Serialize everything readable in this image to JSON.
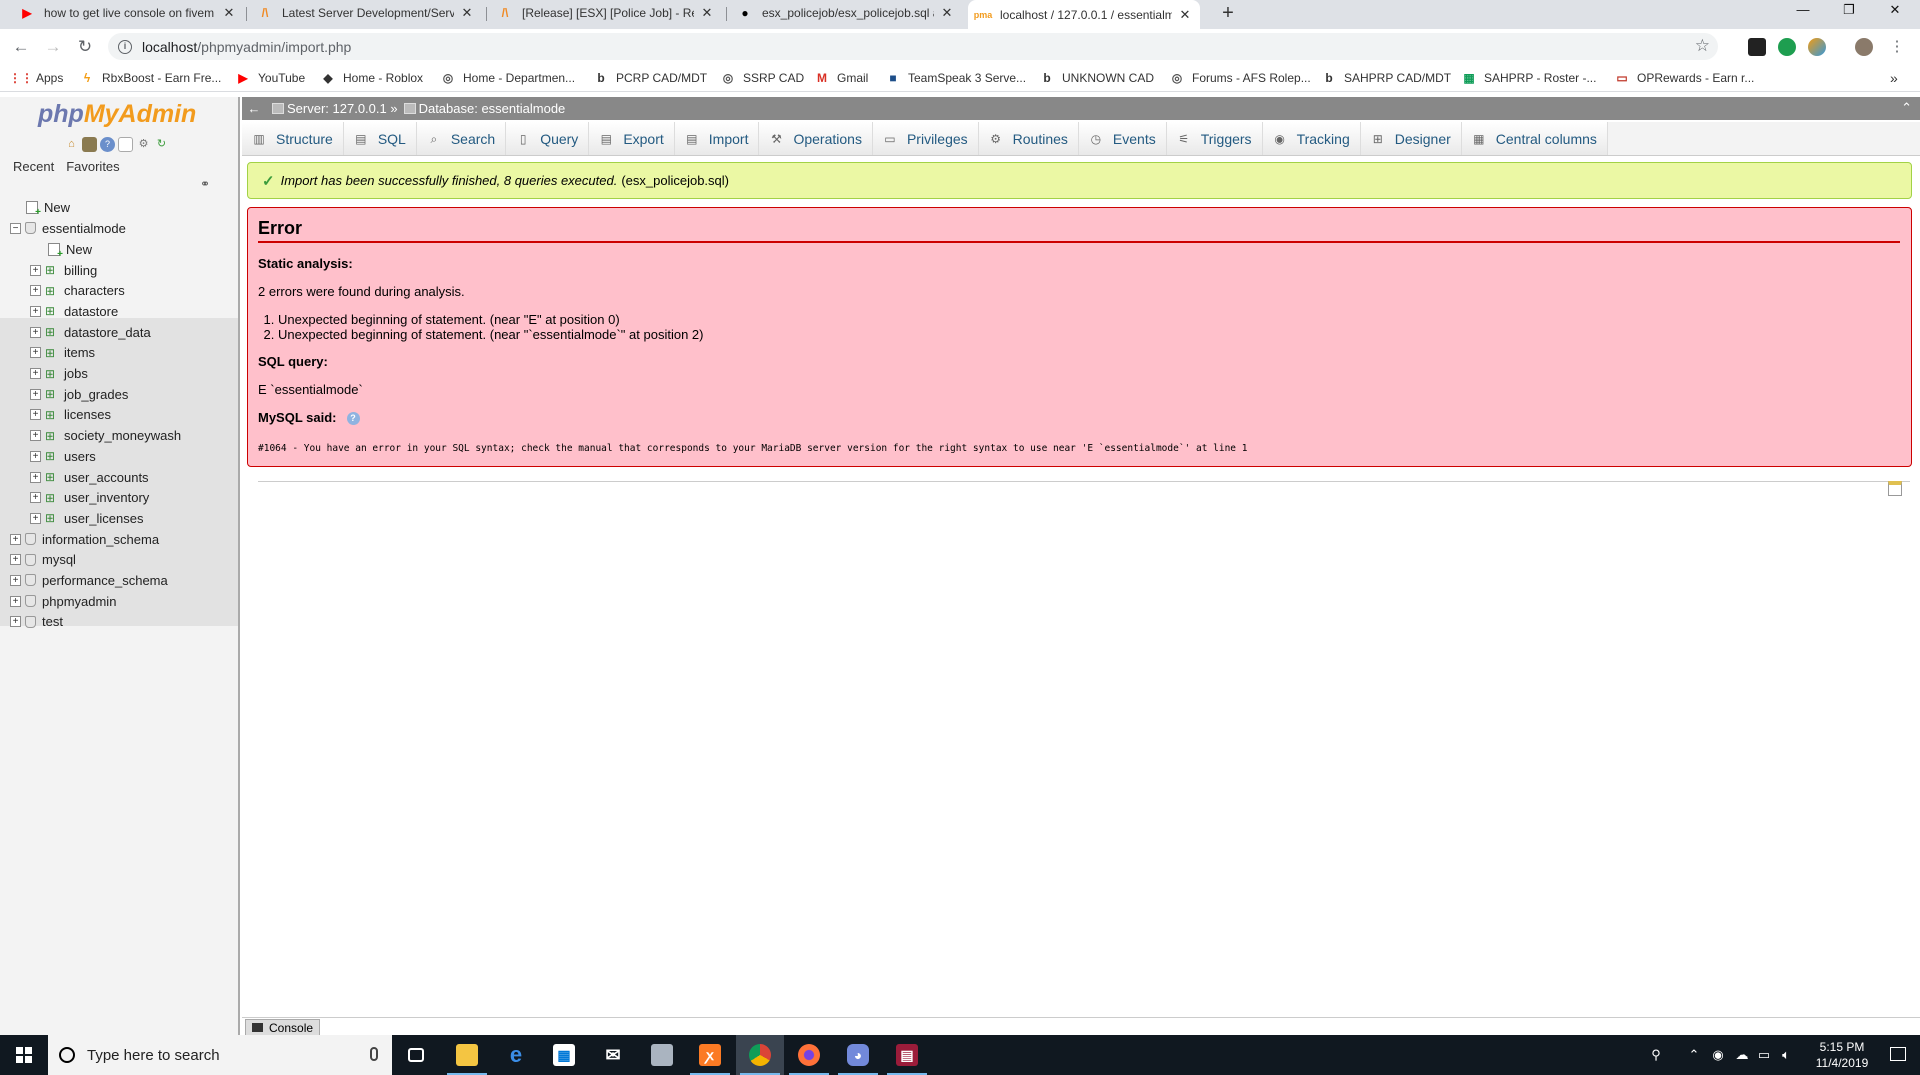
{
  "browser": {
    "tabs": [
      {
        "title": "how to get live console on fivem",
        "icon": "youtube-icon",
        "color": "#ff0000"
      },
      {
        "title": "Latest Server Development/Serve",
        "icon": "fivem-icon",
        "color": "#f08a24"
      },
      {
        "title": "[Release] [ESX] [Police Job] - Rele",
        "icon": "fivem-icon",
        "color": "#f08a24"
      },
      {
        "title": "esx_policejob/esx_policejob.sql at",
        "icon": "github-icon",
        "color": "#000000"
      },
      {
        "title": "localhost / 127.0.0.1 / essentialm",
        "icon": "phpmyadmin-icon",
        "color": "#f29b1d"
      }
    ],
    "url_host": "localhost",
    "url_path": "/phpmyadmin/import.php",
    "bookmarks": [
      {
        "label": "Apps",
        "icon": "apps-grid-icon",
        "color": "#d93025"
      },
      {
        "label": "RbxBoost - Earn Fre...",
        "icon": "lightning-icon",
        "color": "#f39c12"
      },
      {
        "label": "YouTube",
        "icon": "youtube-icon",
        "color": "#ff0000"
      },
      {
        "label": "Home - Roblox",
        "icon": "roblox-icon",
        "color": "#333333"
      },
      {
        "label": "Home - Departmen...",
        "icon": "globe-icon",
        "color": "#555555"
      },
      {
        "label": "PCRP CAD/MDT",
        "icon": "b-logo-icon",
        "color": "#000000"
      },
      {
        "label": "SSRP CAD",
        "icon": "globe-icon",
        "color": "#555555"
      },
      {
        "label": "Gmail",
        "icon": "gmail-icon",
        "color": "#d93025"
      },
      {
        "label": "TeamSpeak 3 Serve...",
        "icon": "teamspeak-icon",
        "color": "#1d4e89"
      },
      {
        "label": "UNKNOWN CAD",
        "icon": "b-logo-icon",
        "color": "#000000"
      },
      {
        "label": "Forums - AFS Rolep...",
        "icon": "globe-icon",
        "color": "#555555"
      },
      {
        "label": "SAHPRP CAD/MDT",
        "icon": "b-logo-icon",
        "color": "#000000"
      },
      {
        "label": "SAHPRP - Roster -...",
        "icon": "sheets-icon",
        "color": "#0f9d58"
      },
      {
        "label": "OPRewards - Earn r...",
        "icon": "oprewards-icon",
        "color": "#c0392b"
      }
    ]
  },
  "pma": {
    "logo_php": "php",
    "logo_my": "MyAdmin",
    "nav_tabs": [
      "Recent",
      "Favorites"
    ],
    "tree": {
      "new_label": "New",
      "active_db": "essentialmode",
      "active_db_new": "New",
      "tables": [
        "billing",
        "characters",
        "datastore",
        "datastore_data",
        "items",
        "jobs",
        "job_grades",
        "licenses",
        "society_moneywash",
        "users",
        "user_accounts",
        "user_inventory",
        "user_licenses"
      ],
      "other_dbs": [
        "information_schema",
        "mysql",
        "performance_schema",
        "phpmyadmin",
        "test"
      ]
    },
    "breadcrumb": {
      "server": "Server: 127.0.0.1 »",
      "database": "Database: essentialmode"
    },
    "menu": [
      {
        "label": "Structure",
        "icon": "structure-icon"
      },
      {
        "label": "SQL",
        "icon": "sql-icon"
      },
      {
        "label": "Search",
        "icon": "search-icon"
      },
      {
        "label": "Query",
        "icon": "query-icon"
      },
      {
        "label": "Export",
        "icon": "export-icon"
      },
      {
        "label": "Import",
        "icon": "import-icon"
      },
      {
        "label": "Operations",
        "icon": "wrench-icon"
      },
      {
        "label": "Privileges",
        "icon": "privileges-icon"
      },
      {
        "label": "Routines",
        "icon": "routines-icon"
      },
      {
        "label": "Events",
        "icon": "clock-icon"
      },
      {
        "label": "Triggers",
        "icon": "triggers-icon"
      },
      {
        "label": "Tracking",
        "icon": "eye-icon"
      },
      {
        "label": "Designer",
        "icon": "designer-icon"
      },
      {
        "label": "Central columns",
        "icon": "central-columns-icon"
      }
    ],
    "success_message": "Import has been successfully finished, 8 queries executed.",
    "success_file": "(esx_policejob.sql)",
    "error": {
      "title": "Error",
      "static_analysis_label": "Static analysis:",
      "errors_found": "2 errors were found during analysis.",
      "items": [
        "Unexpected beginning of statement. (near \"E\" at position 0)",
        "Unexpected beginning of statement. (near \"`essentialmode`\" at position 2)"
      ],
      "sql_query_label": "SQL query:",
      "sql_query": "E `essentialmode`",
      "mysql_said_label": "MySQL said:",
      "mysql_said": "#1064 - You have an error in your SQL syntax; check the manual that corresponds to your MariaDB server version for the right syntax to use near 'E `essentialmode`' at line 1"
    },
    "console_label": "Console"
  },
  "taskbar": {
    "search_placeholder": "Type here to search",
    "time": "5:15 PM",
    "date": "11/4/2019"
  }
}
